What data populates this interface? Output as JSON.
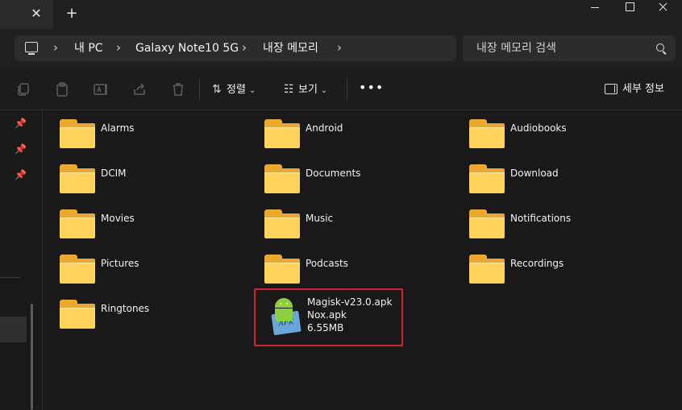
{
  "window": {
    "tab_close_glyph": "✕",
    "tab_add_glyph": "+"
  },
  "address": {
    "crumbs": [
      "내 PC",
      "Galaxy Note10 5G",
      "내장 메모리"
    ],
    "separator": "›",
    "search_placeholder": "내장 메모리 검색"
  },
  "toolbar": {
    "sort_label": "정렬",
    "view_label": "보기",
    "more_label": "•••",
    "details_label": "세부 정보",
    "chevron": "⌄",
    "sort_glyph": "⇅",
    "view_glyph": "☷"
  },
  "nav": {
    "pin_glyph": "📌"
  },
  "folders": [
    {
      "name": "Alarms"
    },
    {
      "name": "Android"
    },
    {
      "name": "Audiobooks"
    },
    {
      "name": "DCIM"
    },
    {
      "name": "Documents"
    },
    {
      "name": "Download"
    },
    {
      "name": "Movies"
    },
    {
      "name": "Music"
    },
    {
      "name": "Notifications"
    },
    {
      "name": "Pictures"
    },
    {
      "name": "Podcasts"
    },
    {
      "name": "Recordings"
    },
    {
      "name": "Ringtones"
    }
  ],
  "apk_file": {
    "name": "Magisk-v23.0.apk",
    "type": "Nox.apk",
    "size": "6.55MB",
    "icon_label": "APK",
    "highlight_color": "#d3222a"
  },
  "colors": {
    "folder_front": "#ffd35c",
    "folder_back": "#e8a92e",
    "background": "#191919"
  }
}
